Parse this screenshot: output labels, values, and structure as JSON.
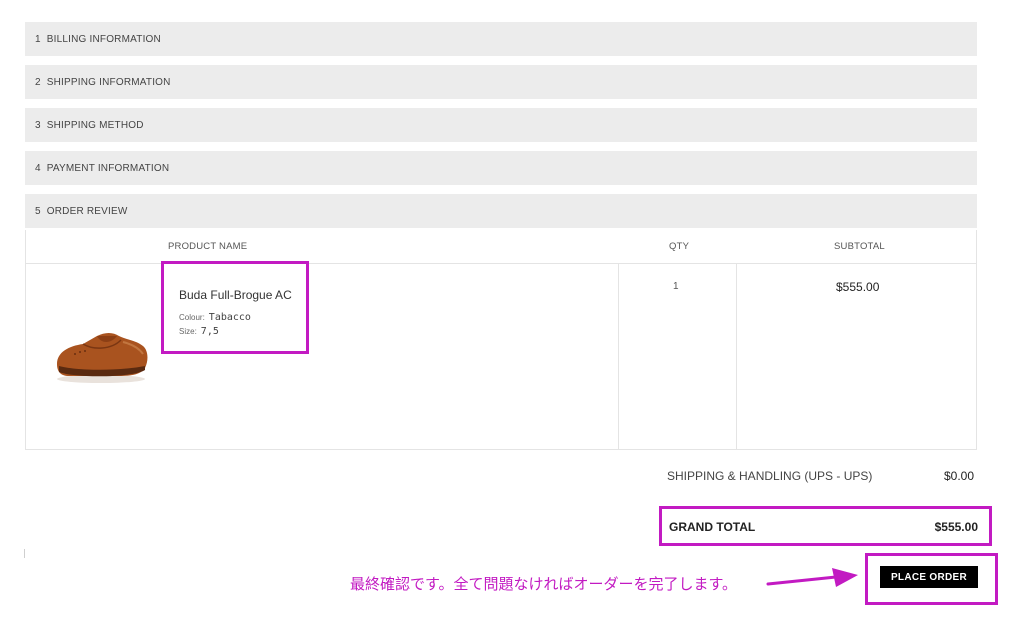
{
  "steps": [
    {
      "num": "1",
      "label": "BILLING INFORMATION"
    },
    {
      "num": "2",
      "label": "SHIPPING INFORMATION"
    },
    {
      "num": "3",
      "label": "SHIPPING METHOD"
    },
    {
      "num": "4",
      "label": "PAYMENT INFORMATION"
    },
    {
      "num": "5",
      "label": "ORDER REVIEW"
    }
  ],
  "review": {
    "headers": {
      "product_name": "PRODUCT NAME",
      "qty": "QTY",
      "subtotal": "SUBTOTAL"
    },
    "item": {
      "name": "Buda Full-Brogue AC",
      "colour_label": "Colour:",
      "colour_value": "Tabacco",
      "size_label": "Size:",
      "size_value": "7,5",
      "qty": "1",
      "subtotal": "$555.00"
    }
  },
  "totals": {
    "shipping_label": "SHIPPING & HANDLING (UPS - UPS)",
    "shipping_value": "$0.00",
    "grand_total_label": "GRAND TOTAL",
    "grand_total_value": "$555.00"
  },
  "actions": {
    "place_order_label": "PLACE ORDER"
  },
  "annotation": {
    "text": "最終確認です。全て問題なければオーダーを完了します。"
  },
  "colors": {
    "highlight": "#c21ac2",
    "step_bg": "#ececec",
    "button_bg": "#000000"
  }
}
